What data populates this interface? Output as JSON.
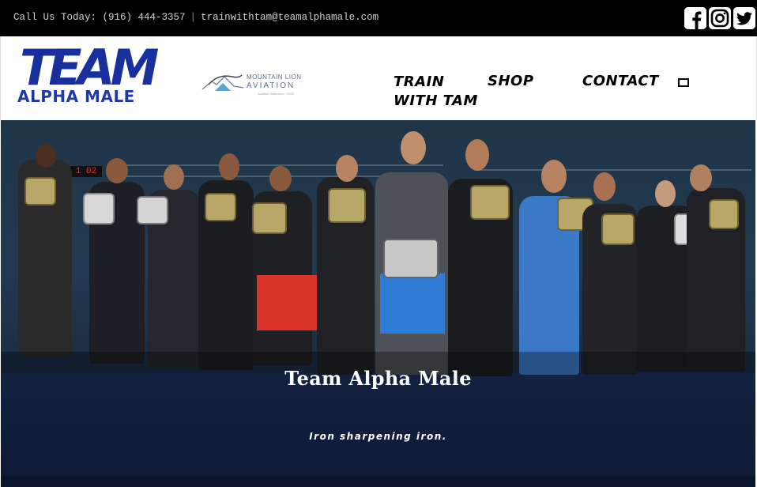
{
  "topbar": {
    "phone": "Call Us Today: (916) 444-3357",
    "separator": "|",
    "email": "trainwithtam@teamalphamale.com",
    "social": [
      "facebook-icon",
      "instagram-icon",
      "twitter-icon"
    ]
  },
  "header": {
    "logo_team": "TEAM",
    "logo_subtitle": "ALPHA MALE",
    "partner_name_line1": "MOUNTAIN LION",
    "partner_name_line2": "AVIATION",
    "partner_tag": "Aviation Distinction · 2002"
  },
  "nav": {
    "items": [
      "TRAIN WITH TAM",
      "SHOP",
      "CONTACT"
    ],
    "train_line1": "TRAIN",
    "train_line2": "WITH TAM",
    "shop": "SHOP",
    "contact": "CONTACT"
  },
  "hero": {
    "title": "Team Alpha Male",
    "subtitle": "Iron sharpening iron.",
    "clock": "1 02"
  },
  "colors": {
    "topbar_bg": "#000000",
    "logo_blue": "#1e3aa6",
    "text_light": "#cfcfcf"
  }
}
